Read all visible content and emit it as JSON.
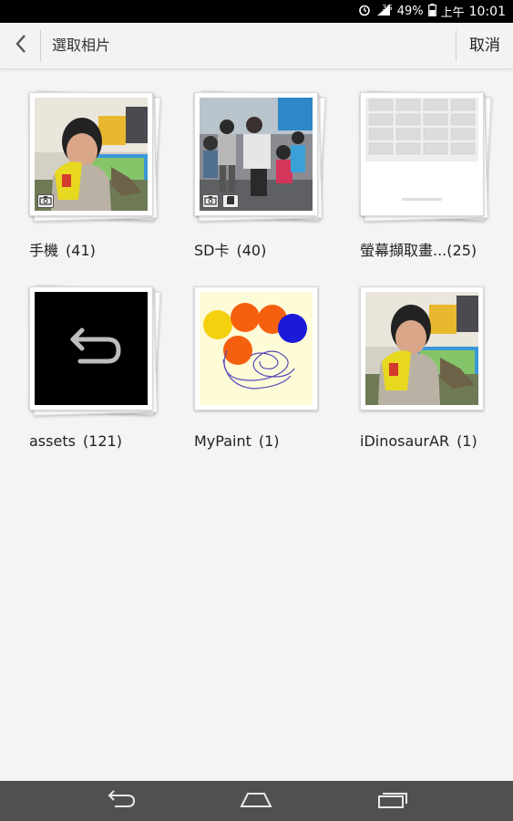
{
  "status_bar": {
    "battery": "49%",
    "time_period": "上午",
    "time": "10:01",
    "network": "3G"
  },
  "app_bar": {
    "title": "選取相片",
    "cancel_label": "取消",
    "back_icon": "chevron-left-icon"
  },
  "albums": [
    {
      "name": "手機",
      "count": "(41)",
      "badges": [
        "camera-icon"
      ]
    },
    {
      "name": "SD卡",
      "count": "(40)",
      "badges": [
        "camera-icon",
        "sd-card-icon"
      ]
    },
    {
      "name": "螢幕擷取畫...",
      "count": "(25)",
      "badges": []
    },
    {
      "name": "assets",
      "count": "(121)",
      "badges": []
    },
    {
      "name": "MyPaint",
      "count": "(1)",
      "badges": []
    },
    {
      "name": "iDinosaurAR",
      "count": "(1)",
      "badges": []
    }
  ],
  "nav_bar": {
    "icons": [
      "back-icon",
      "home-icon",
      "recent-apps-icon"
    ]
  },
  "colors": {
    "status_bg": "#000000",
    "app_bar_bg": "#f3f3f3",
    "page_bg": "#f4f4f4",
    "nav_bg": "#505050"
  }
}
